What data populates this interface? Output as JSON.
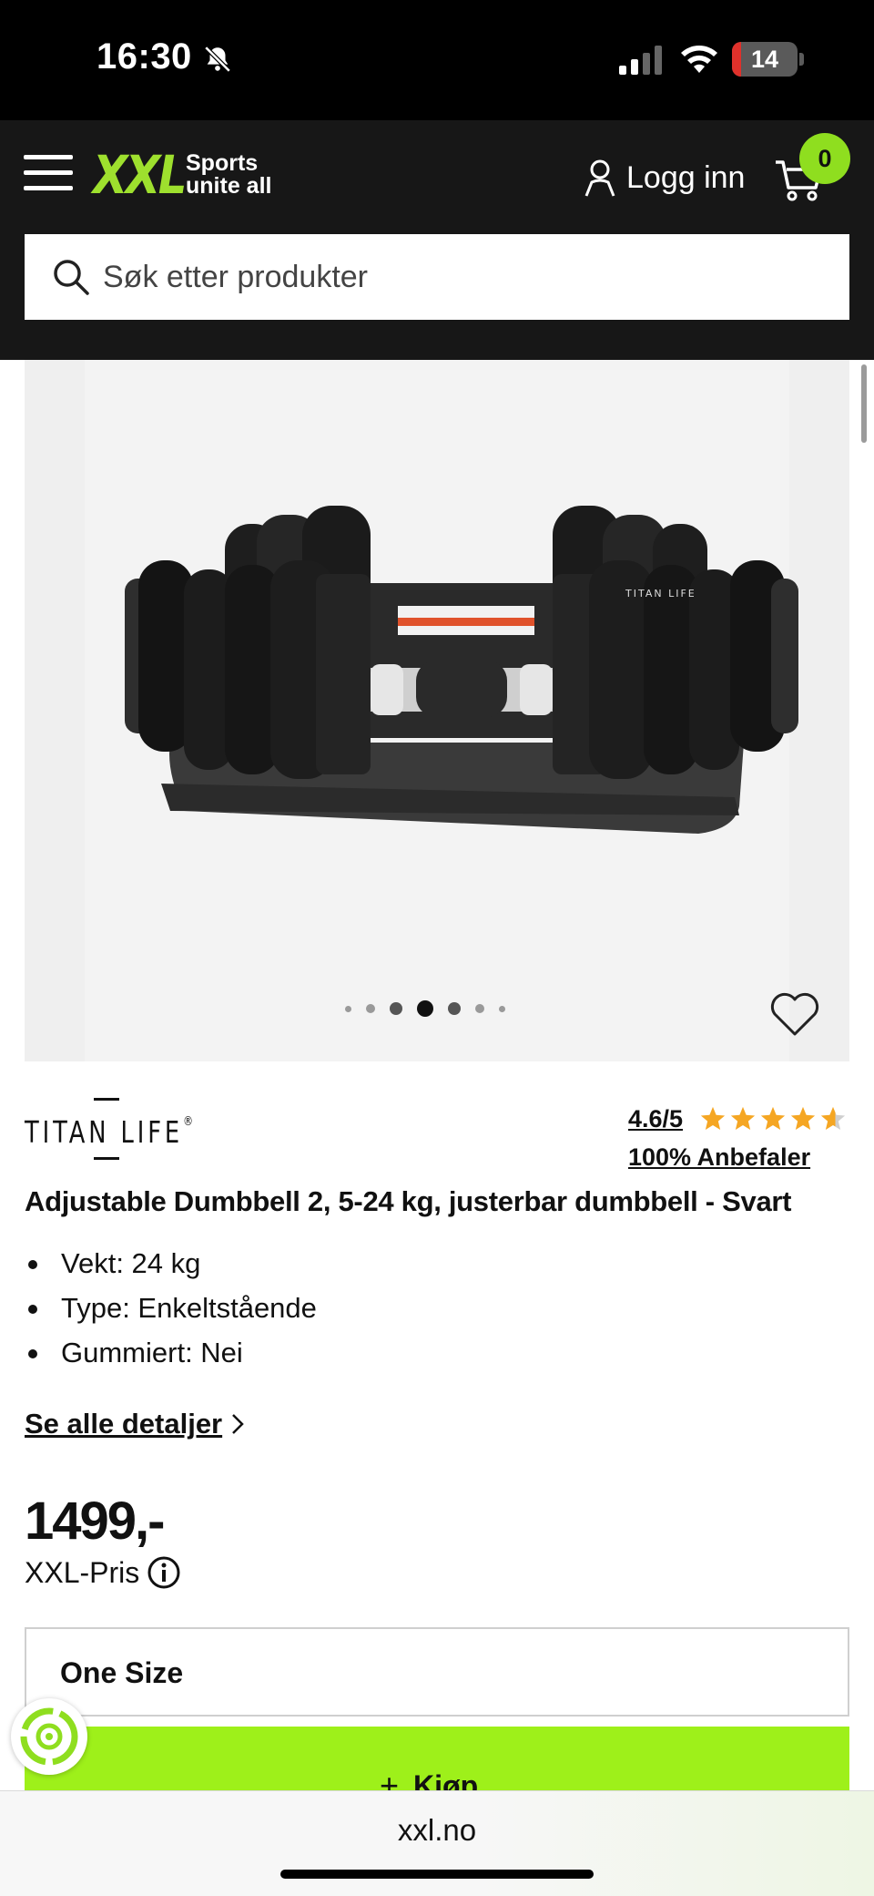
{
  "status_bar": {
    "time": "16:30",
    "battery_level": "14",
    "battery_fraction": 0.14,
    "icons": [
      "bell-off-icon",
      "signal-icon",
      "wifi-icon",
      "battery-icon"
    ]
  },
  "header": {
    "logo_text": "XXL",
    "logo_tagline_line1": "Sports",
    "logo_tagline_line2": "unite all",
    "login_label": "Logg inn",
    "cart_count": "0",
    "search_placeholder": "Søk etter produkter",
    "colors": {
      "background": "#171717",
      "brand_green": "#9ee02e"
    }
  },
  "gallery": {
    "dot_count": 7,
    "active_dot": 3,
    "favorite_icon": "heart-icon"
  },
  "product": {
    "brand": "TITAN LIFE",
    "brand_mark": "®",
    "rating": "4.6/5",
    "rating_value": 4.6,
    "rating_max": 5,
    "recommend": "100% Anbefaler",
    "title": "Adjustable Dumbbell 2, 5-24 kg, justerbar dumbbell - Svart",
    "specs": [
      "Vekt: 24 kg",
      "Type: Enkeltstående",
      "Gummiert: Nei"
    ],
    "details_link": "Se alle detaljer",
    "price": "1499,-",
    "price_label": "XXL-Pris",
    "size": "One Size",
    "buy_label": "Kjøp",
    "colors": {
      "buy_button": "#9ef01a",
      "star": "#f5a623"
    }
  },
  "browser": {
    "url": "xxl.no"
  }
}
